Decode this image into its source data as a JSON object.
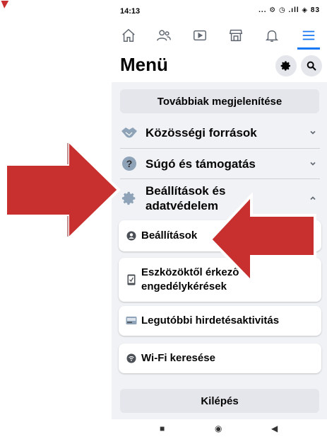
{
  "statusbar": {
    "time": "14:13",
    "icons": "... ⚙ ◷ .ıll ◈ 83"
  },
  "nav": [
    "home-icon",
    "friends-icon",
    "watch-icon",
    "marketplace-icon",
    "notifications-icon",
    "menu-icon"
  ],
  "header": {
    "title": "Menü"
  },
  "more_button": "Továbbiak megjelenítése",
  "sections": [
    {
      "label": "Közösségi források",
      "icon": "handshake-icon"
    },
    {
      "label": "Súgó és támogatás",
      "icon": "help-icon"
    },
    {
      "label": "Beállítások és adatvédelem",
      "icon": "gear-icon"
    }
  ],
  "settings_items": [
    {
      "label": "Beállítások",
      "icon": "profile-icon"
    },
    {
      "label": "Eszközöktől érkező engedélykérések",
      "icon": "device-icon"
    },
    {
      "label": "Legutóbbi hirdetésaktivitás",
      "icon": "ads-icon"
    },
    {
      "label": "Wi-Fi keresése",
      "icon": "wifi-icon"
    }
  ],
  "logout": "Kilépés",
  "colors": {
    "accent": "#1877f2",
    "arrow": "#c8302f",
    "background": "#f0f2f5"
  }
}
